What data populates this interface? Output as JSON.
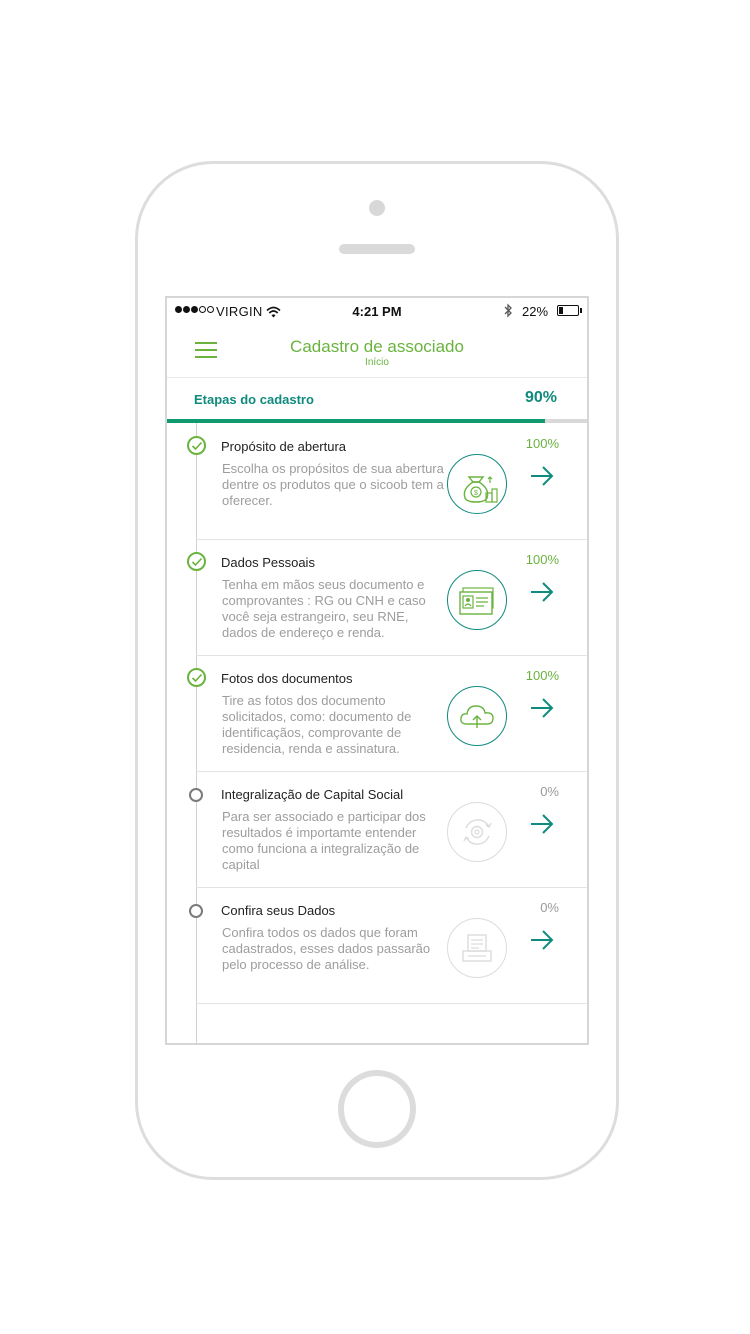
{
  "status_bar": {
    "carrier": "VIRGIN",
    "time": "4:21 PM",
    "battery": "22%",
    "battery_level": 0.22
  },
  "header": {
    "title": "Cadastro de associado",
    "subtitle": "Início"
  },
  "progress": {
    "label": "Etapas do cadastro",
    "value_text": "90%",
    "value": 0.9
  },
  "steps": [
    {
      "title": "Propósito de abertura",
      "description": "Escolha os propósitos de sua abertura dentre os produtos que o sicoob tem a oferecer.",
      "percent": "100%",
      "completed": true,
      "icon": "money-bag-coins-icon"
    },
    {
      "title": "Dados Pessoais",
      "description": "Tenha em mãos seus documento e comprovantes : RG ou CNH e caso você seja estrangeiro, seu RNE, dados de endereço e renda.",
      "percent": "100%",
      "completed": true,
      "icon": "id-card-icon"
    },
    {
      "title": "Fotos dos documentos",
      "description": "Tire as fotos dos documento solicitados, como: documento de identificaçãos, comprovante de residencia, renda e assinatura.",
      "percent": "100%",
      "completed": true,
      "icon": "cloud-upload-icon"
    },
    {
      "title": "Integralização de Capital Social",
      "description": "Para ser associado e participar dos resultados é importamte entender como funciona a integralização de capital",
      "percent": "0%",
      "completed": false,
      "icon": "refresh-gear-icon"
    },
    {
      "title": "Confira seus Dados",
      "description": "Confira todos os dados que foram cadastrados, esses dados passarão pelo processo de análise.",
      "percent": "0%",
      "completed": false,
      "icon": "document-printer-icon"
    }
  ],
  "colors": {
    "brand_green": "#6ab33f",
    "teal": "#118a7e",
    "progress_fill": "#0f9a6f",
    "muted": "#9d9d9d"
  }
}
